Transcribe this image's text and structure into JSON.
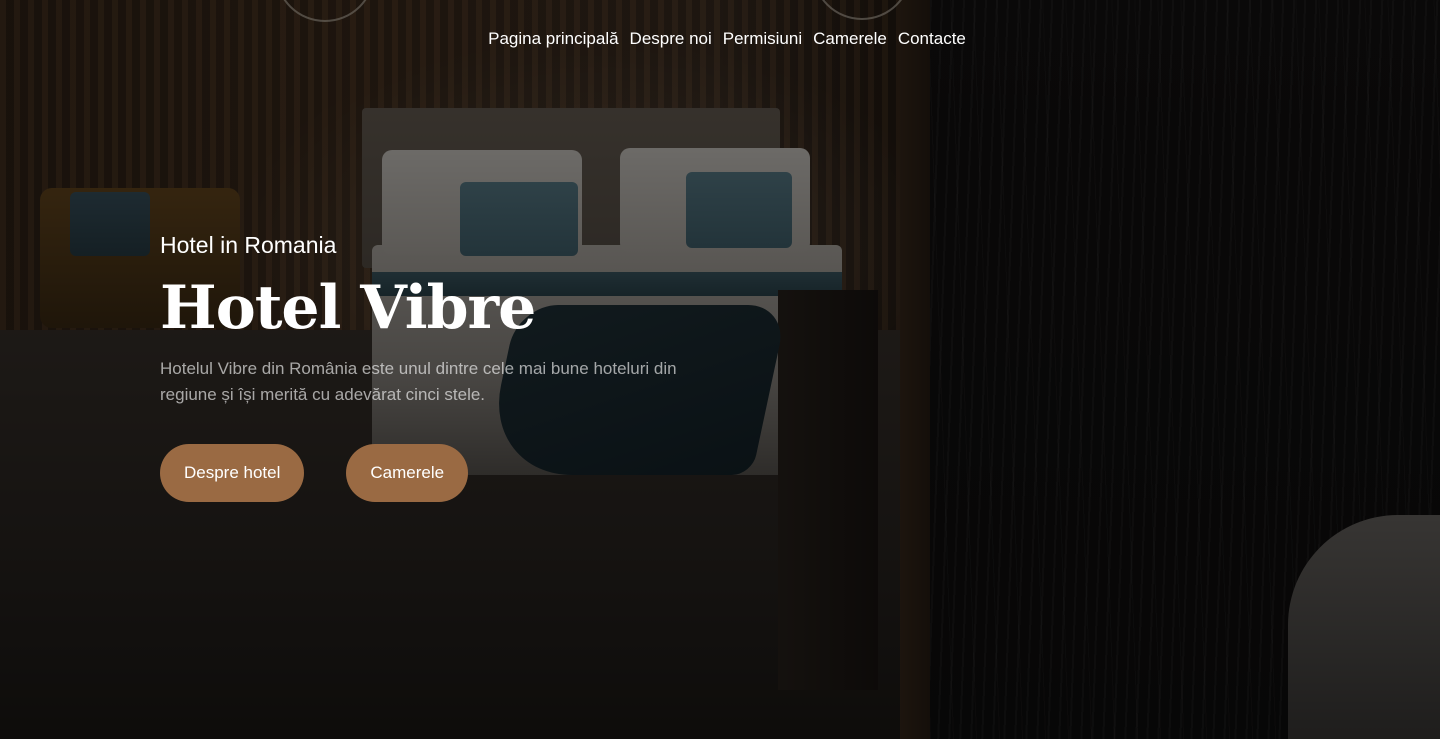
{
  "nav": {
    "items": [
      {
        "label": "Pagina principală"
      },
      {
        "label": "Despre noi"
      },
      {
        "label": "Permisiuni"
      },
      {
        "label": "Camerele"
      },
      {
        "label": "Contacte"
      }
    ]
  },
  "hero": {
    "eyebrow": "Hotel in Romania",
    "title": "Hotel Vibre",
    "description": "Hotelul Vibre din România este unul dintre cele mai bune hoteluri din regiune și își merită cu adevărat cinci stele.",
    "buttons": [
      {
        "label": "Despre hotel"
      },
      {
        "label": "Camerele"
      }
    ],
    "background_image": "hotel-room-photo"
  },
  "colors": {
    "button_bg": "#9a6a43",
    "text_primary": "#ffffff",
    "overlay": "rgba(0,0,0,0.5)"
  }
}
